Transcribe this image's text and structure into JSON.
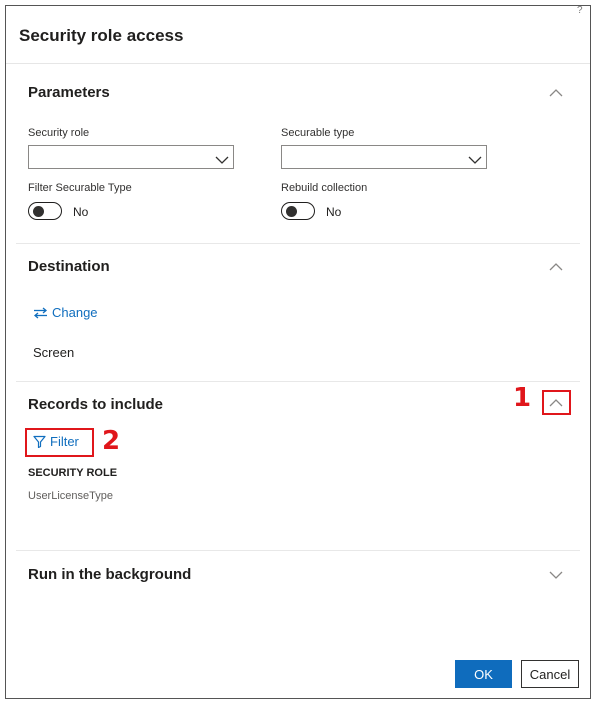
{
  "dialog": {
    "title": "Security role access",
    "help_mark": "?"
  },
  "parameters": {
    "header": "Parameters",
    "security_role": {
      "label": "Security role",
      "value": ""
    },
    "securable_type": {
      "label": "Securable type",
      "value": ""
    },
    "filter_securable_type": {
      "label": "Filter Securable Type",
      "state": "No"
    },
    "rebuild_collection": {
      "label": "Rebuild collection",
      "state": "No"
    }
  },
  "destination": {
    "header": "Destination",
    "change_label": "Change",
    "value": "Screen"
  },
  "records": {
    "header": "Records to include",
    "filter_label": "Filter",
    "column_header": "SECURITY ROLE",
    "column_value": "UserLicenseType"
  },
  "background": {
    "header": "Run in the background"
  },
  "callouts": {
    "one": "1",
    "two": "2"
  },
  "footer": {
    "ok_label": "OK",
    "cancel_label": "Cancel"
  },
  "colors": {
    "accent": "#0f6cbd",
    "link": "#106ebe",
    "callout": "#e0161b"
  },
  "icons": {
    "chevron_up": "chevron-up-icon",
    "chevron_down": "chevron-down-icon",
    "swap": "swap-arrows-icon",
    "filter": "funnel-icon"
  }
}
